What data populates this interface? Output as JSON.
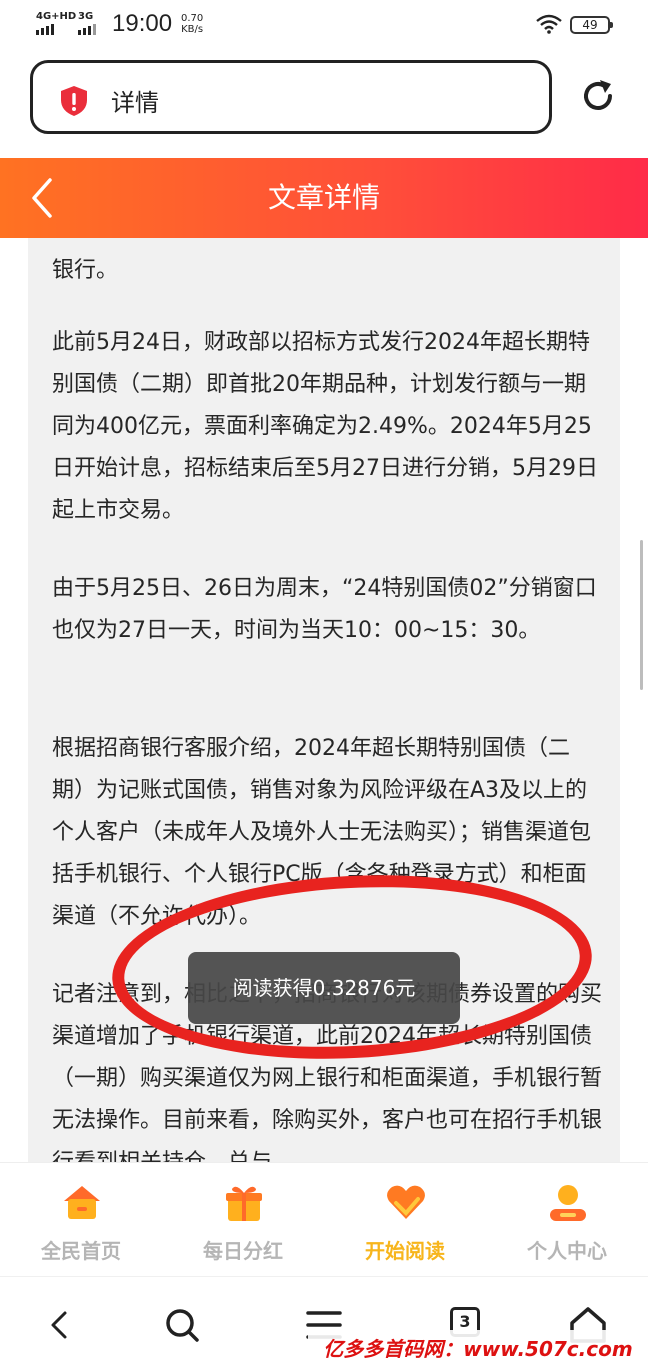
{
  "status_bar": {
    "network_primary": "4G+HD",
    "network_secondary": "3G",
    "time": "19:00",
    "speed_value": "0.70",
    "speed_unit": "KB/s",
    "battery": "49"
  },
  "address_bar": {
    "title": "详情",
    "icon": "shield-alert-icon"
  },
  "header": {
    "title": "文章详情"
  },
  "article": {
    "paragraphs": [
      "银行。",
      "此前5月24日，财政部以招标方式发行2024年超长期特别国债（二期）即首批20年期品种，计划发行额与一期同为400亿元，票面利率确定为2.49%。2024年5月25日开始计息，招标结束后至5月27日进行分销，5月29日起上市交易。",
      "由于5月25日、26日为周末，“24特别国债02”分销窗口也仅为27日一天，时间为当天10：00~15：30。",
      "根据招商银行客服介绍，2024年超长期特别国债（二期）为记账式国债，销售对象为风险评级在A3及以上的个人客户（未成年人及境外人士无法购买）；销售渠道包括手机银行、个人银行PC版（含各种登录方式）和柜面渠道（不允许代办）。",
      "记者注意到，相比之下，招商银行对该期债券设置的购买渠道增加了手机银行渠道，此前2024年超长期特别国债（一期）购买渠道仅为网上银行和柜面渠道，手机银行暂无法操作。目前来看，除购买外，客户也可在招行手机银行看到相关持仓、兑与"
    ]
  },
  "toast": {
    "text": "阅读获得0.32876元"
  },
  "tabs": [
    {
      "label": "全民首页",
      "icon": "home-icon",
      "active": false
    },
    {
      "label": "每日分红",
      "icon": "gift-icon",
      "active": false
    },
    {
      "label": "开始阅读",
      "icon": "heart-tag-icon",
      "active": true
    },
    {
      "label": "个人中心",
      "icon": "user-icon",
      "active": false
    }
  ],
  "nav_bar": {
    "tab_count": "3"
  },
  "watermark": "亿多多首码网：www.507c.com",
  "colors": {
    "header_start": "#ff7222",
    "header_end": "#ff2b48",
    "active_tab": "#f7b51c",
    "ring": "#e8231f"
  }
}
